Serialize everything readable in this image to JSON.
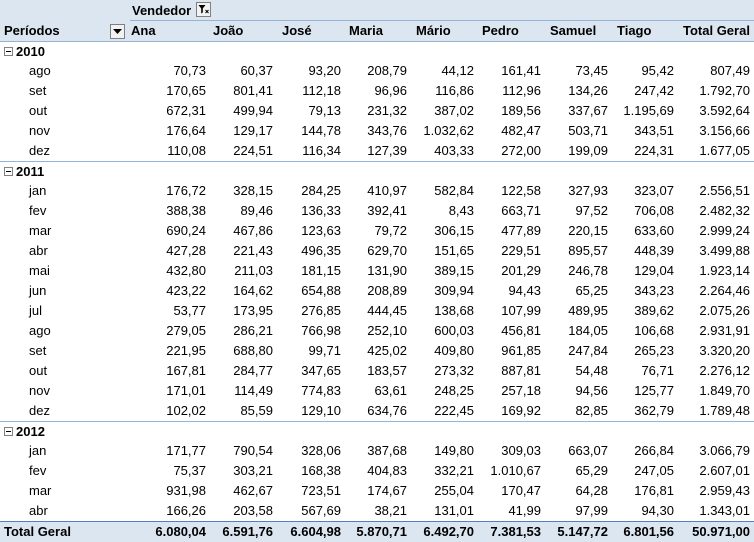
{
  "pivot": {
    "column_field_label": "Vendedor",
    "row_field_label": "Períodos",
    "columns": [
      "Ana",
      "João",
      "José",
      "Maria",
      "Mário",
      "Pedro",
      "Samuel",
      "Tiago",
      "Total Geral"
    ],
    "years": [
      {
        "year": "2010",
        "months": [
          {
            "month": "ago",
            "values": [
              "70,73",
              "60,37",
              "93,20",
              "208,79",
              "44,12",
              "161,41",
              "73,45",
              "95,42",
              "807,49"
            ]
          },
          {
            "month": "set",
            "values": [
              "170,65",
              "801,41",
              "112,18",
              "96,96",
              "116,86",
              "112,96",
              "134,26",
              "247,42",
              "1.792,70"
            ]
          },
          {
            "month": "out",
            "values": [
              "672,31",
              "499,94",
              "79,13",
              "231,32",
              "387,02",
              "189,56",
              "337,67",
              "1.195,69",
              "3.592,64"
            ]
          },
          {
            "month": "nov",
            "values": [
              "176,64",
              "129,17",
              "144,78",
              "343,76",
              "1.032,62",
              "482,47",
              "503,71",
              "343,51",
              "3.156,66"
            ]
          },
          {
            "month": "dez",
            "values": [
              "110,08",
              "224,51",
              "116,34",
              "127,39",
              "403,33",
              "272,00",
              "199,09",
              "224,31",
              "1.677,05"
            ]
          }
        ]
      },
      {
        "year": "2011",
        "months": [
          {
            "month": "jan",
            "values": [
              "176,72",
              "328,15",
              "284,25",
              "410,97",
              "582,84",
              "122,58",
              "327,93",
              "323,07",
              "2.556,51"
            ]
          },
          {
            "month": "fev",
            "values": [
              "388,38",
              "89,46",
              "136,33",
              "392,41",
              "8,43",
              "663,71",
              "97,52",
              "706,08",
              "2.482,32"
            ]
          },
          {
            "month": "mar",
            "values": [
              "690,24",
              "467,86",
              "123,63",
              "79,72",
              "306,15",
              "477,89",
              "220,15",
              "633,60",
              "2.999,24"
            ]
          },
          {
            "month": "abr",
            "values": [
              "427,28",
              "221,43",
              "496,35",
              "629,70",
              "151,65",
              "229,51",
              "895,57",
              "448,39",
              "3.499,88"
            ]
          },
          {
            "month": "mai",
            "values": [
              "432,80",
              "211,03",
              "181,15",
              "131,90",
              "389,15",
              "201,29",
              "246,78",
              "129,04",
              "1.923,14"
            ]
          },
          {
            "month": "jun",
            "values": [
              "423,22",
              "164,62",
              "654,88",
              "208,89",
              "309,94",
              "94,43",
              "65,25",
              "343,23",
              "2.264,46"
            ]
          },
          {
            "month": "jul",
            "values": [
              "53,77",
              "173,95",
              "276,85",
              "444,45",
              "138,68",
              "107,99",
              "489,95",
              "389,62",
              "2.075,26"
            ]
          },
          {
            "month": "ago",
            "values": [
              "279,05",
              "286,21",
              "766,98",
              "252,10",
              "600,03",
              "456,81",
              "184,05",
              "106,68",
              "2.931,91"
            ]
          },
          {
            "month": "set",
            "values": [
              "221,95",
              "688,80",
              "99,71",
              "425,02",
              "409,80",
              "961,85",
              "247,84",
              "265,23",
              "3.320,20"
            ]
          },
          {
            "month": "out",
            "values": [
              "167,81",
              "284,77",
              "347,65",
              "183,57",
              "273,32",
              "887,81",
              "54,48",
              "76,71",
              "2.276,12"
            ]
          },
          {
            "month": "nov",
            "values": [
              "171,01",
              "114,49",
              "774,83",
              "63,61",
              "248,25",
              "257,18",
              "94,56",
              "125,77",
              "1.849,70"
            ]
          },
          {
            "month": "dez",
            "values": [
              "102,02",
              "85,59",
              "129,10",
              "634,76",
              "222,45",
              "169,92",
              "82,85",
              "362,79",
              "1.789,48"
            ]
          }
        ]
      },
      {
        "year": "2012",
        "months": [
          {
            "month": "jan",
            "values": [
              "171,77",
              "790,54",
              "328,06",
              "387,68",
              "149,80",
              "309,03",
              "663,07",
              "266,84",
              "3.066,79"
            ]
          },
          {
            "month": "fev",
            "values": [
              "75,37",
              "303,21",
              "168,38",
              "404,83",
              "332,21",
              "1.010,67",
              "65,29",
              "247,05",
              "2.607,01"
            ]
          },
          {
            "month": "mar",
            "values": [
              "931,98",
              "462,67",
              "723,51",
              "174,67",
              "255,04",
              "170,47",
              "64,28",
              "176,81",
              "2.959,43"
            ]
          },
          {
            "month": "abr",
            "values": [
              "166,26",
              "203,58",
              "567,69",
              "38,21",
              "131,01",
              "41,99",
              "97,99",
              "94,30",
              "1.343,01"
            ]
          }
        ]
      }
    ],
    "grand_total": {
      "label": "Total Geral",
      "values": [
        "6.080,04",
        "6.591,76",
        "6.604,98",
        "5.870,71",
        "6.492,70",
        "7.381,53",
        "5.147,72",
        "6.801,56",
        "50.971,00"
      ]
    },
    "icons": {
      "filter": "filter-funnel-icon",
      "dropdown": "chevron-down-icon",
      "collapse": "collapse-minus-icon"
    },
    "colors": {
      "header_bg": "#dce6f1",
      "border": "#95b3d7",
      "total_border": "#4f81bd"
    }
  }
}
